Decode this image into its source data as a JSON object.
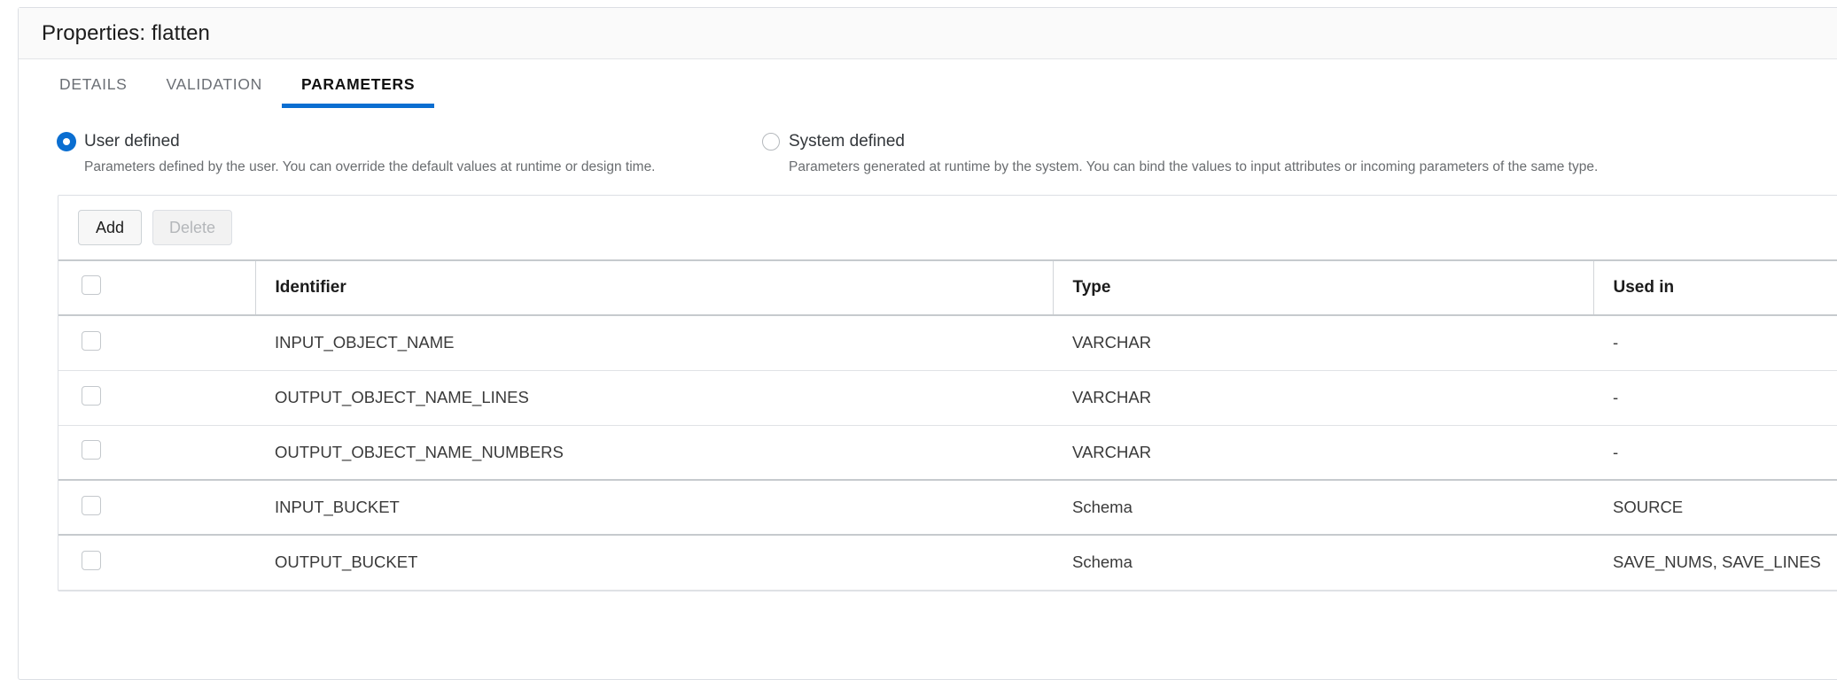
{
  "window": {
    "title": "Properties: flatten"
  },
  "tabs": [
    {
      "label": "DETAILS",
      "active": false
    },
    {
      "label": "VALIDATION",
      "active": false
    },
    {
      "label": "PARAMETERS",
      "active": true
    }
  ],
  "radio_options": [
    {
      "label": "User defined",
      "description": "Parameters defined by the user. You can override the default values at runtime or design time.",
      "selected": true
    },
    {
      "label": "System defined",
      "description": "Parameters generated at runtime by the system. You can bind the values to input attributes or incoming parameters of the same type.",
      "selected": false
    }
  ],
  "toolbar": {
    "add_label": "Add",
    "delete_label": "Delete"
  },
  "table": {
    "columns": [
      "",
      "Identifier",
      "Type",
      "Used in"
    ],
    "rows": [
      {
        "identifier": "INPUT_OBJECT_NAME",
        "type": "VARCHAR",
        "used_in": "-"
      },
      {
        "identifier": "OUTPUT_OBJECT_NAME_LINES",
        "type": "VARCHAR",
        "used_in": "-"
      },
      {
        "identifier": "OUTPUT_OBJECT_NAME_NUMBERS",
        "type": "VARCHAR",
        "used_in": "-"
      },
      {
        "identifier": "INPUT_BUCKET",
        "type": "Schema",
        "used_in": "SOURCE"
      },
      {
        "identifier": "OUTPUT_BUCKET",
        "type": "Schema",
        "used_in": "SAVE_NUMS, SAVE_LINES"
      }
    ]
  },
  "colors": {
    "accent": "#0a6ed1",
    "header_bg": "#fafafa",
    "border": "#dcdfe4",
    "text": "#32363a",
    "muted_text": "#6a6d70"
  }
}
